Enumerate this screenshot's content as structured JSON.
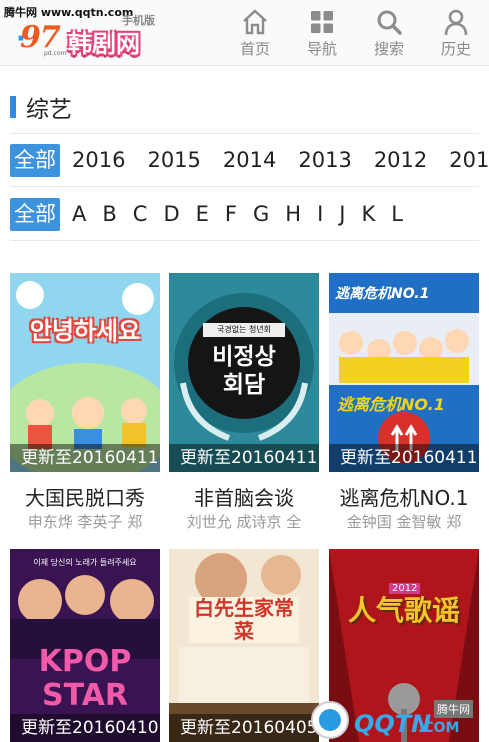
{
  "site": {
    "watermark_top": "腾牛网 www.qqtn.com",
    "logo_num": "97",
    "logo_name": "韩剧网",
    "logo_sub": "手机版",
    "logo_small": "pd.com"
  },
  "nav": [
    {
      "label": "首页",
      "icon": "home-icon"
    },
    {
      "label": "导航",
      "icon": "grid-icon"
    },
    {
      "label": "搜索",
      "icon": "search-icon"
    },
    {
      "label": "历史",
      "icon": "user-icon"
    }
  ],
  "section": {
    "title": "综艺"
  },
  "filters": {
    "all_label": "全部",
    "years": [
      "2016",
      "2015",
      "2014",
      "2013",
      "2012",
      "201"
    ],
    "letters": [
      "A",
      "B",
      "C",
      "D",
      "E",
      "F",
      "G",
      "H",
      "I",
      "J",
      "K",
      "L"
    ]
  },
  "shows": [
    {
      "title": "大国民脱口秀",
      "cast": "申东烨 李英子 郑",
      "update": "更新至20160411",
      "poster_text": "안녕하세요",
      "colors": {
        "bg": "#7fd0ec",
        "accent": "#f7d13c"
      }
    },
    {
      "title": "非首脑会谈",
      "cast": "刘世允 成诗京 全",
      "update": "更新至20160411",
      "poster_text": "비정상 회담",
      "poster_sub": "국경없는 청년회",
      "colors": {
        "bg": "#2c8a9a",
        "accent": "#1b1b1b"
      }
    },
    {
      "title": "逃离危机NO.1",
      "cast": "金钟国 金智敏 郑",
      "update": "更新至20160411",
      "poster_text": "逃离危机NO.1",
      "colors": {
        "bg": "#1f6fc4",
        "accent": "#f3d21f"
      }
    },
    {
      "title": "",
      "cast": "",
      "update": "更新至20160410",
      "poster_text": "KPOP STAR",
      "poster_sub": "이제 당신의 노래가 들려주세요",
      "colors": {
        "bg": "#3a1452",
        "accent": "#e64ca0"
      }
    },
    {
      "title": "",
      "cast": "",
      "update": "更新至20160405",
      "poster_text": "白先生家常菜",
      "colors": {
        "bg": "#f2e7d2",
        "accent": "#e36a2a"
      }
    },
    {
      "title": "",
      "cast": "",
      "update": "",
      "poster_text": "人气歌谣",
      "poster_sub": "2012",
      "colors": {
        "bg": "#b0151c",
        "accent": "#f6c52b"
      }
    }
  ],
  "watermark_bottom": {
    "brand": "QQTN",
    "suffix": ".COM",
    "badge": "腾牛网"
  }
}
